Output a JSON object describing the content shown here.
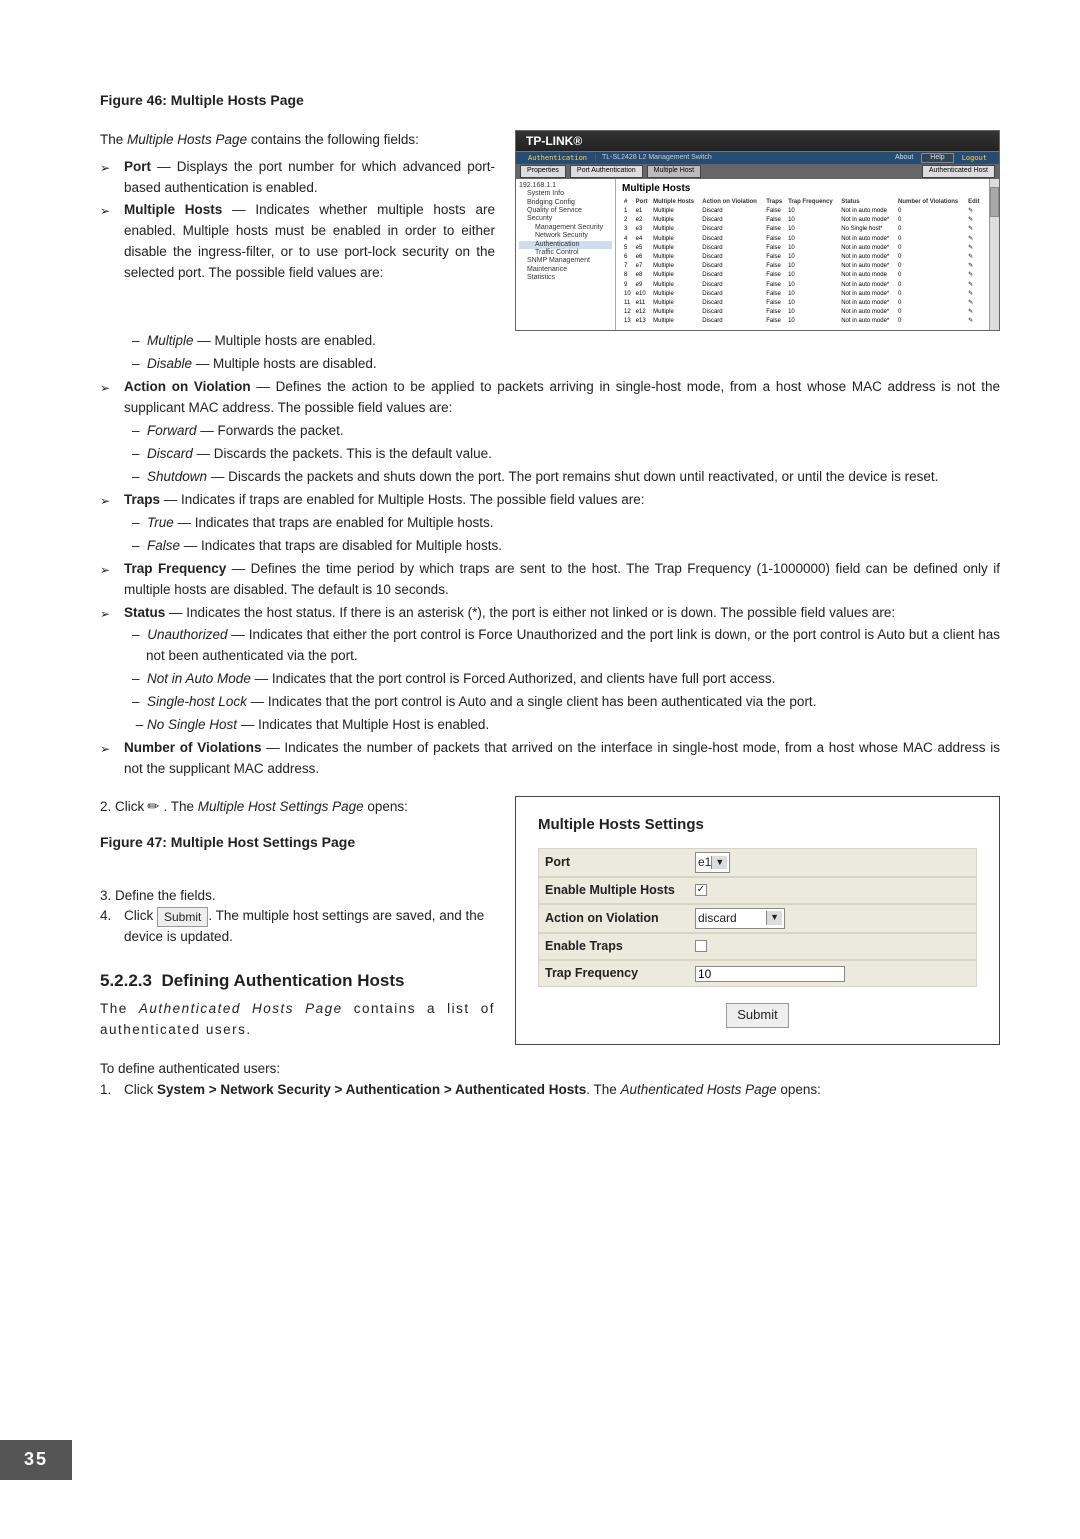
{
  "page_number": "35",
  "figure46": {
    "title": "Figure 46: Multiple Hosts Page",
    "intro": "The Multiple Hosts Page contains the following fields:",
    "port": {
      "label": "Port",
      "desc": " — Displays the port number for which advanced port-based authentication is enabled."
    },
    "multiple_hosts": {
      "label": "Multiple Hosts",
      "desc": " — Indicates whether multiple hosts are enabled. Multiple hosts must be enabled in order to either disable the ingress-filter, or to use port-lock security on the selected port. The possible field values are:"
    },
    "mh_multiple": {
      "em": "Multiple",
      "rest": " — Multiple hosts are enabled."
    },
    "mh_disable": {
      "em": "Disable",
      "rest": " — Multiple hosts are disabled."
    },
    "aov": {
      "label": "Action on Violation",
      "rest": " — Defines the action to be applied to packets arriving in single-host mode, from a host whose MAC address is not the supplicant MAC address. The possible field values are:"
    },
    "aov_forward": {
      "em": "Forward",
      "rest": " — Forwards the packet."
    },
    "aov_discard": {
      "em": "Discard",
      "rest": " — Discards the packets. This is the default value."
    },
    "aov_shutdown": {
      "em": "Shutdown",
      "rest": " — Discards the packets and shuts down the port. The port remains shut down until reactivated, or until the device is reset."
    },
    "traps": {
      "label": "Traps",
      "rest": " — Indicates if traps are enabled for Multiple Hosts. The possible field values are:"
    },
    "traps_true": {
      "em": "True",
      "rest": " — Indicates that traps are enabled for Multiple hosts."
    },
    "traps_false": {
      "em": "False",
      "rest": " — Indicates that traps are disabled for Multiple hosts."
    },
    "trap_freq": {
      "label": "Trap Frequency",
      "rest": " — Defines the time period by which traps are sent to the host. The Trap Frequency (1-1000000) field can be defined only if multiple hosts are disabled. The default is 10 seconds."
    },
    "status": {
      "label": "Status",
      "rest": " — Indicates the host status. If there is an asterisk (*), the port is either not linked or is down. The possible field values are:"
    },
    "st_unauth": {
      "em": "Unauthorized",
      "rest": " — Indicates that either the port control is Force Unauthorized and the port link is down, or the port control is Auto but a client has not been authenticated via the port."
    },
    "st_notinauto": {
      "em": "Not in Auto Mode",
      "rest": " — Indicates that the port control is Forced Authorized, and clients have full port access."
    },
    "st_singlelock": {
      "em": "Single-host Lock",
      "rest": " — Indicates that the port control is Auto and a single client has been authenticated via the port."
    },
    "st_nosingle": {
      "em": "No Single Host",
      "rest": " — Indicates that Multiple Host is enabled."
    },
    "nov": {
      "label": "Number of Violations",
      "rest": " — Indicates the number of packets that arrived on the interface in single-host mode, from a host whose MAC address is not the supplicant MAC address."
    }
  },
  "step2": {
    "pre": "2.   Click ",
    "post": " . The Multiple Host Settings Page opens:"
  },
  "figure47_title": "Figure 47: Multiple Host Settings Page",
  "step3": "3.   Define the fields.",
  "step4": {
    "n": "4.",
    "pre": "Click ",
    "btn": "Submit",
    "post": ". The multiple host settings are saved, and the device is updated."
  },
  "sec_52223": {
    "num": "5.2.2.3",
    "title": "Defining Authentication Hosts"
  },
  "sec_52223_desc": "The Authenticated Hosts Page contains a list of authenticated users.",
  "to_define": "To define authenticated users:",
  "step1b": {
    "n": "1.",
    "pre": "Click ",
    "path": "System > Network Security > Authentication > Authenticated Hosts",
    "post": ". The Authenticated Hosts Page opens:"
  },
  "screenshot": {
    "brand": "TP-LINK®",
    "model": "TL-SL2428 L2 Management Switch",
    "about": "About",
    "help": "Help",
    "logout": "Logout",
    "auth": "Authentication",
    "tabs": [
      "Properties",
      "Port Authentication",
      "Multiple Host",
      "Authenticated Host"
    ],
    "tree": [
      "192.168.1.1",
      "System Info",
      "Bridging Config",
      "Quality of Service",
      "Security",
      "Management Security",
      "Network Security",
      "Authentication",
      "Traffic Control",
      "SNMP Management",
      "Maintenance",
      "Statistics"
    ],
    "heading": "Multiple Hosts",
    "headers": [
      "#",
      "Port",
      "Multiple Hosts",
      "Action on Violation",
      "Traps",
      "Trap Frequency",
      "Status",
      "Number of Violations",
      "Edit"
    ]
  },
  "chart_data": {
    "type": "table",
    "columns": [
      "#",
      "Port",
      "Multiple Hosts",
      "Action on Violation",
      "Traps",
      "Trap Frequency",
      "Status",
      "Number of Violations",
      "Edit"
    ],
    "rows": [
      [
        1,
        "e1",
        "Multiple",
        "Discard",
        "False",
        10,
        "Not in auto mode",
        0,
        "edit"
      ],
      [
        2,
        "e2",
        "Multiple",
        "Discard",
        "False",
        10,
        "Not in auto mode*",
        0,
        "edit"
      ],
      [
        3,
        "e3",
        "Multiple",
        "Discard",
        "False",
        10,
        "No Single host*",
        0,
        "edit"
      ],
      [
        4,
        "e4",
        "Multiple",
        "Discard",
        "False",
        10,
        "Not in auto mode*",
        0,
        "edit"
      ],
      [
        5,
        "e5",
        "Multiple",
        "Discard",
        "False",
        10,
        "Not in auto mode*",
        0,
        "edit"
      ],
      [
        6,
        "e6",
        "Multiple",
        "Discard",
        "False",
        10,
        "Not in auto mode*",
        0,
        "edit"
      ],
      [
        7,
        "e7",
        "Multiple",
        "Discard",
        "False",
        10,
        "Not in auto mode*",
        0,
        "edit"
      ],
      [
        8,
        "e8",
        "Multiple",
        "Discard",
        "False",
        10,
        "Not in auto mode",
        0,
        "edit"
      ],
      [
        9,
        "e9",
        "Multiple",
        "Discard",
        "False",
        10,
        "Not in auto mode*",
        0,
        "edit"
      ],
      [
        10,
        "e10",
        "Multiple",
        "Discard",
        "False",
        10,
        "Not in auto mode*",
        0,
        "edit"
      ],
      [
        11,
        "e11",
        "Multiple",
        "Discard",
        "False",
        10,
        "Not in auto mode*",
        0,
        "edit"
      ],
      [
        12,
        "e12",
        "Multiple",
        "Discard",
        "False",
        10,
        "Not in auto mode*",
        0,
        "edit"
      ],
      [
        13,
        "e13",
        "Multiple",
        "Discard",
        "False",
        10,
        "Not in auto mode*",
        0,
        "edit"
      ]
    ]
  },
  "settings": {
    "title": "Multiple Hosts Settings",
    "port_label": "Port",
    "port_value": "e1",
    "enable_label": "Enable Multiple Hosts",
    "aov_label": "Action on Violation",
    "aov_value": "discard",
    "traps_label": "Enable Traps",
    "freq_label": "Trap Frequency",
    "freq_value": "10",
    "submit": "Submit"
  }
}
